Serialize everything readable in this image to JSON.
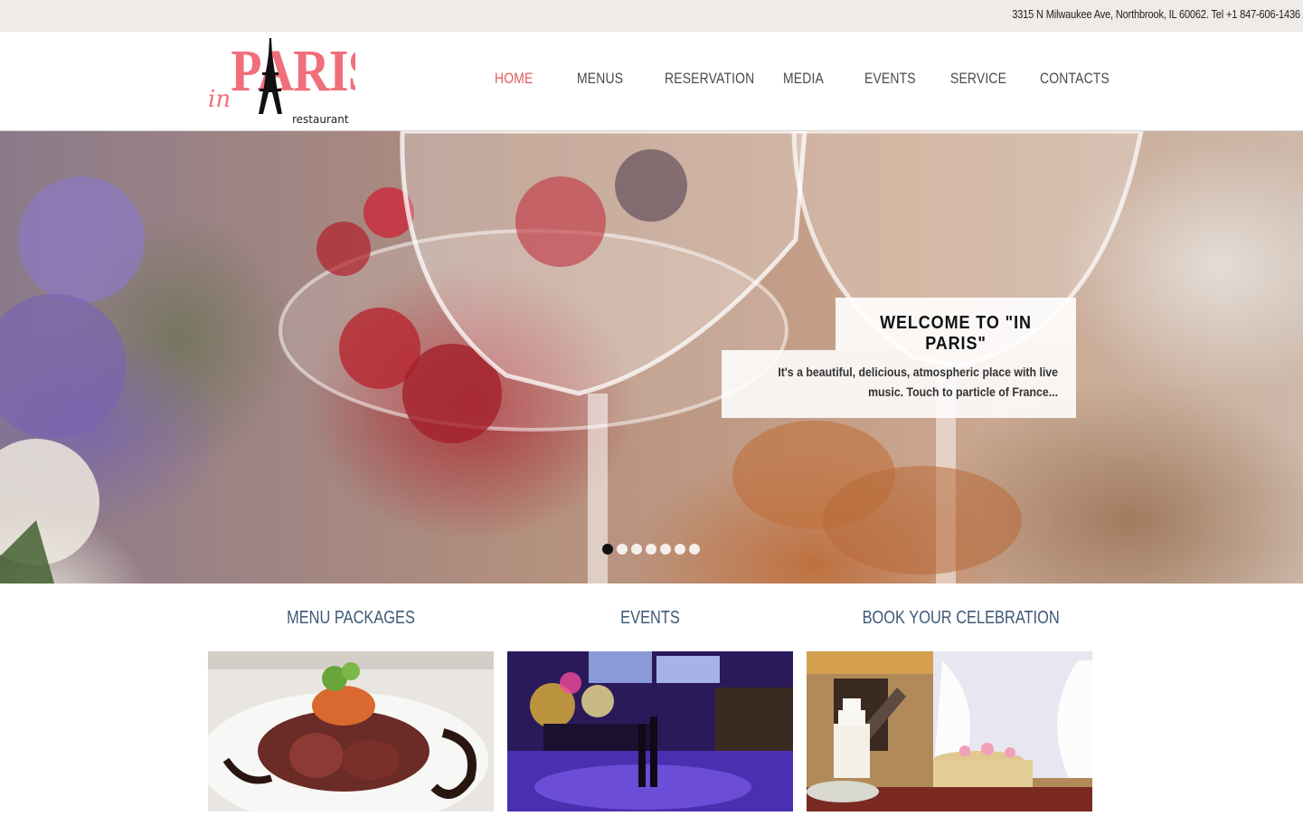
{
  "topbar": {
    "address": "3315 N Milwaukee Ave, Northbrook, IL 60062. Tel +1 847-606-1436"
  },
  "logo": {
    "prefix": "in",
    "name": "PARIS",
    "subtitle": "restaurant",
    "color": "#f06f7b"
  },
  "nav": {
    "items": [
      {
        "label": "HOME",
        "active": true
      },
      {
        "label": "MENUS",
        "active": false
      },
      {
        "label": "RESERVATION",
        "active": false
      },
      {
        "label": "MEDIA",
        "active": false
      },
      {
        "label": "EVENTS",
        "active": false
      },
      {
        "label": "SERVICE",
        "active": false
      },
      {
        "label": "CONTACTS",
        "active": false
      }
    ],
    "active_color": "#e35a5a",
    "text_color": "#4a4a4a"
  },
  "hero": {
    "title": "WELCOME TO \"IN PARIS\"",
    "description": "It's a beautiful, delicious, atmospheric place with live music. Touch to particle of France...",
    "slide_count": 7,
    "active_slide": 1
  },
  "sections": [
    {
      "title": "MENU PACKAGES",
      "image": "food-plate"
    },
    {
      "title": "EVENTS",
      "image": "dance-hall"
    },
    {
      "title": "BOOK YOUR CELEBRATION",
      "image": "banquet-hall"
    }
  ],
  "colors": {
    "section_title": "#3f5a77",
    "topbar_bg": "#efece7"
  }
}
